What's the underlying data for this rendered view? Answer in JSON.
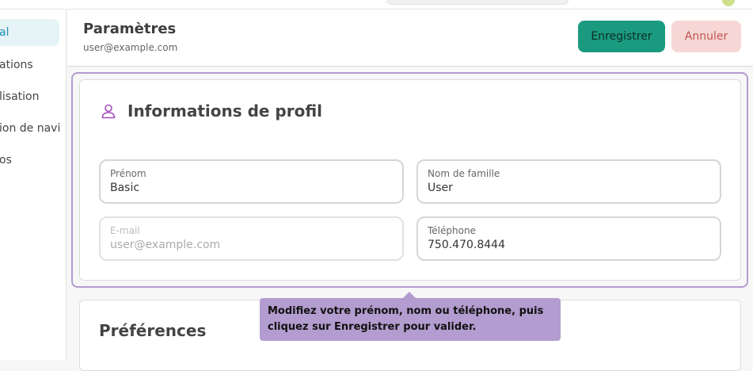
{
  "sidebar": {
    "items": [
      {
        "label": "al",
        "active": true
      },
      {
        "label": "ations",
        "active": false
      },
      {
        "label": "lisation",
        "active": false
      },
      {
        "label": "ion de navi",
        "active": false
      },
      {
        "label": "os",
        "active": false
      }
    ]
  },
  "header": {
    "title": "Paramètres",
    "subtitle": "user@example.com",
    "save_label": "Enregistrer",
    "cancel_label": "Annuler"
  },
  "profile": {
    "icon": "user-icon",
    "title": "Informations de profil",
    "fields": {
      "first_name": {
        "label": "Prénom",
        "value": "Basic"
      },
      "last_name": {
        "label": "Nom de famille",
        "value": "User"
      },
      "email": {
        "label": "E-mail",
        "value": "user@example.com",
        "disabled": true
      },
      "phone": {
        "label": "Téléphone",
        "value": "750.470.8444"
      }
    }
  },
  "preferences": {
    "title": "Préférences"
  },
  "tooltip": {
    "text": "Modifiez votre prénom, nom ou téléphone, puis cliquez sur Enregistrer pour valider."
  },
  "colors": {
    "accent": "#1a9a7f",
    "cancel": "#f6d7d5",
    "highlight": "#b39ccf",
    "active_nav": "#e6f4f8"
  }
}
